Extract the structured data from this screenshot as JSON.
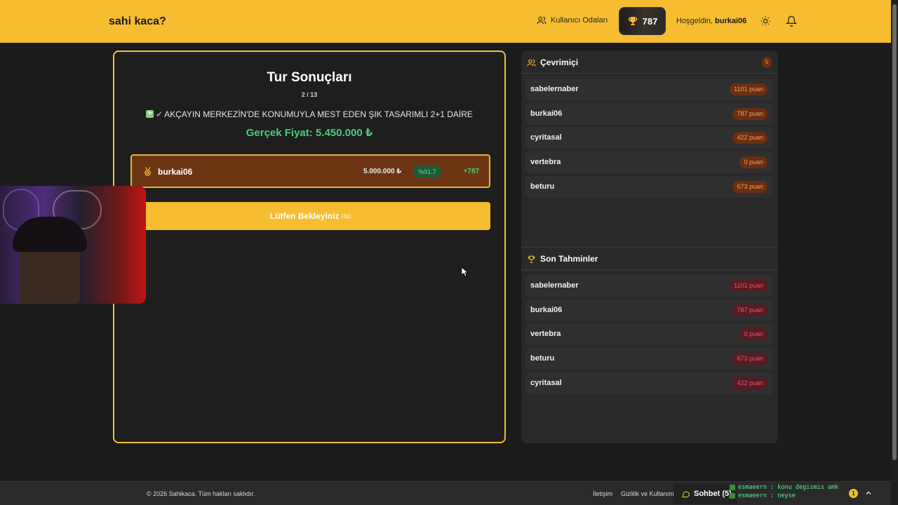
{
  "header": {
    "brand": "sahi kaca?",
    "rooms_label": "Kullanıcı Odaları",
    "score": "787",
    "welcome_prefix": "Hoşgeldin,",
    "username": "burkai06"
  },
  "round": {
    "title": "Tur Sonuçları",
    "progress": "2 / 13",
    "listing_title": "AKÇAYIN MERKEZİN'DE KONUMUYLA MEST EDEN ŞIK TASARIMLI 2+1 DAİRE",
    "real_price": "Gerçek Fiyat: 5.450.000 ₺",
    "result": {
      "name": "burkai06",
      "guess": "5.000.000 ₺",
      "accuracy": "%91.7",
      "points": "+787"
    },
    "wait_label": "Lütfen Bekleyiniz",
    "countdown": "(3s)"
  },
  "online": {
    "title": "Çevrimiçi",
    "count": "5",
    "players": [
      {
        "name": "sabelernaber",
        "score": "1101 puan"
      },
      {
        "name": "burkai06",
        "score": "787 puan"
      },
      {
        "name": "cyritasal",
        "score": "422 puan"
      },
      {
        "name": "vertebra",
        "score": "0 puan"
      },
      {
        "name": "beturu",
        "score": "673 puan"
      }
    ]
  },
  "recent": {
    "title": "Son Tahminler",
    "players": [
      {
        "name": "sabelernaber",
        "score": "1101 puan"
      },
      {
        "name": "burkai06",
        "score": "787 puan"
      },
      {
        "name": "vertebra",
        "score": "0 puan"
      },
      {
        "name": "beturu",
        "score": "673 puan"
      },
      {
        "name": "cyritasal",
        "score": "422 puan"
      }
    ]
  },
  "footer": {
    "copyright": "© 2026 Sahikaca. Tüm hakları saklıdır.",
    "contact": "İletişim",
    "privacy": "Gizlilik ve Kullanım",
    "chat_label": "Sohbet (5)",
    "chat_lines": [
      "esmaeern : konu degismis amk",
      "esmaeern : neyse"
    ],
    "notif_count": "1"
  },
  "colors": {
    "brand_yellow": "#f5bd2f",
    "success_green": "#4ccc7a",
    "result_bg": "#6c3614",
    "badge_orange": "#f0a060",
    "badge_red": "#e05a6a"
  }
}
